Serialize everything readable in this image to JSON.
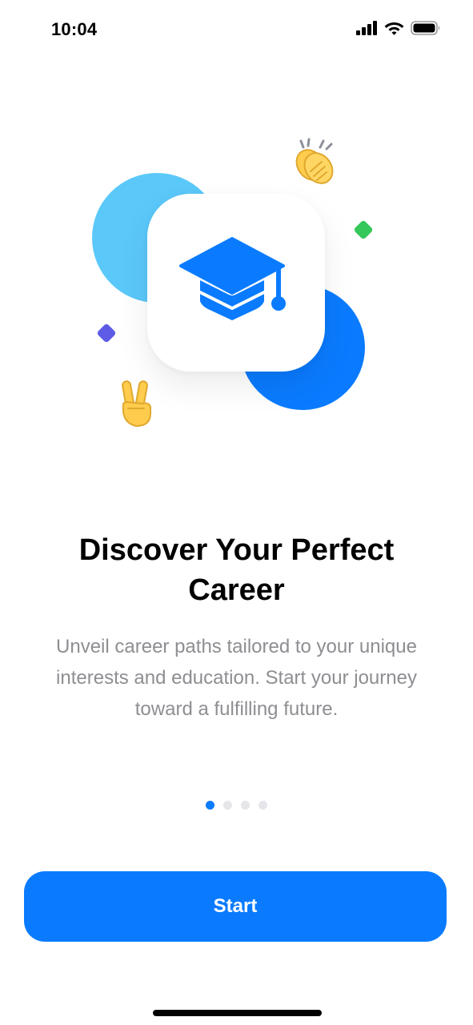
{
  "status_bar": {
    "time": "10:04",
    "icons": [
      "cellular-signal-icon",
      "wifi-icon",
      "battery-icon"
    ]
  },
  "illustration": {
    "main_icon": "graduation-cap-icon",
    "emojis": [
      "👏",
      "✌️"
    ],
    "colors": {
      "light_circle": "#5BC8FA",
      "dark_circle": "#0A7BFF",
      "purple_diamond": "#5E5CE6",
      "green_diamond": "#34C759"
    }
  },
  "onboarding": {
    "title": "Discover Your Perfect Career",
    "description": "Unveil career paths tailored to your unique interests and education. Start your journey toward a fulfilling future."
  },
  "pagination": {
    "total_pages": 4,
    "current_page": 1
  },
  "actions": {
    "start_label": "Start"
  },
  "colors": {
    "accent": "#0A7BFF",
    "text_secondary": "#8E8E93",
    "dot_inactive": "#E5E5EA"
  }
}
